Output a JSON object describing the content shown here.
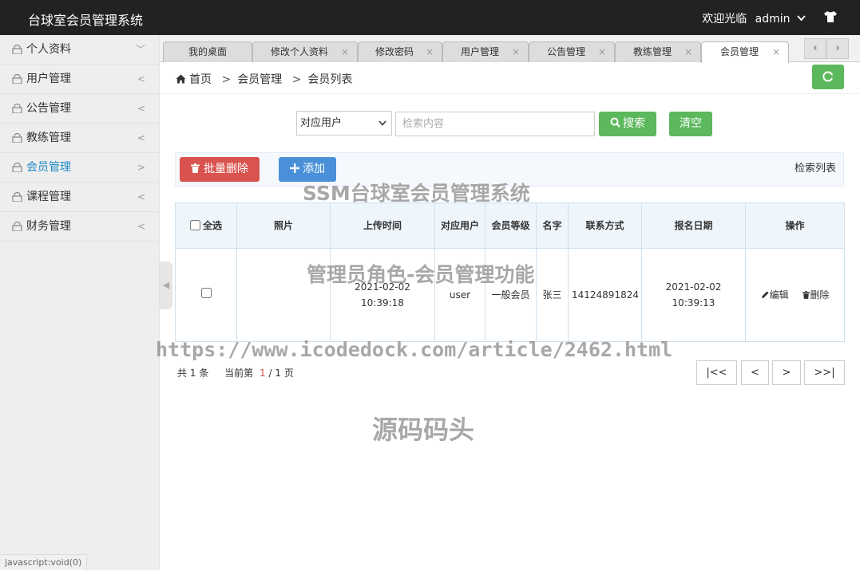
{
  "header": {
    "app_title": "台球室会员管理系统",
    "welcome": "欢迎光临",
    "user": "admin"
  },
  "sidebar": {
    "items": [
      {
        "label": "个人资料",
        "chevron": "﹀"
      },
      {
        "label": "用户管理",
        "chevron": "<"
      },
      {
        "label": "公告管理",
        "chevron": "<"
      },
      {
        "label": "教练管理",
        "chevron": "<"
      },
      {
        "label": "会员管理",
        "chevron": ">"
      },
      {
        "label": "课程管理",
        "chevron": "<"
      },
      {
        "label": "财务管理",
        "chevron": "<"
      }
    ],
    "toggle": "◀",
    "status_url": "javascript:void(0)"
  },
  "tabs": [
    {
      "label": "我的桌面"
    },
    {
      "label": "修改个人资料",
      "close": "×"
    },
    {
      "label": "修改密码",
      "close": "×"
    },
    {
      "label": "用户管理",
      "close": "×"
    },
    {
      "label": "公告管理",
      "close": "×"
    },
    {
      "label": "教练管理",
      "close": "×"
    },
    {
      "label": "会员管理",
      "close": "×"
    }
  ],
  "tab_nav": {
    "prev": "‹",
    "next": "›"
  },
  "breadcrumb": {
    "home": "首页",
    "sep": ">",
    "section": "会员管理",
    "page": "会员列表"
  },
  "search": {
    "select_value": "对应用户",
    "placeholder": "检索内容",
    "search_label": "搜索",
    "clear_label": "清空"
  },
  "toolbar": {
    "batch_delete_label": "批量删除",
    "add_label": "添加",
    "list_label": "检索列表"
  },
  "table": {
    "headers": [
      "全选",
      "照片",
      "上传时间",
      "对应用户",
      "会员等级",
      "名字",
      "联系方式",
      "报名日期",
      "操作"
    ],
    "rows": [
      {
        "photo": "",
        "upload_time": "2021-02-02 10:39:18",
        "user": "user",
        "level": "一般会员",
        "name": "张三",
        "contact": "14124891824",
        "signup_date": "2021-02-02 10:39:13",
        "edit_label": "编辑",
        "delete_label": "删除"
      }
    ]
  },
  "pager": {
    "total_prefix": "共",
    "total": "1",
    "total_suffix": "条",
    "current_prefix": "当前第",
    "current": "1",
    "of": "/",
    "pages": "1",
    "pages_suffix": "页",
    "first": "|<<",
    "prev": "<",
    "next": ">",
    "last": ">>|"
  },
  "watermarks": {
    "line1": "SSM台球室会员管理系统",
    "line2": "管理员角色-会员管理功能",
    "line3": "https://www.icodedock.com/article/2462.html",
    "line4": "源码码头"
  },
  "colors": {
    "topbar": "#222222",
    "active_sidebar": "#1e88c8",
    "green": "#5cb85c",
    "red": "#d9534f",
    "blue": "#4a90d9"
  }
}
